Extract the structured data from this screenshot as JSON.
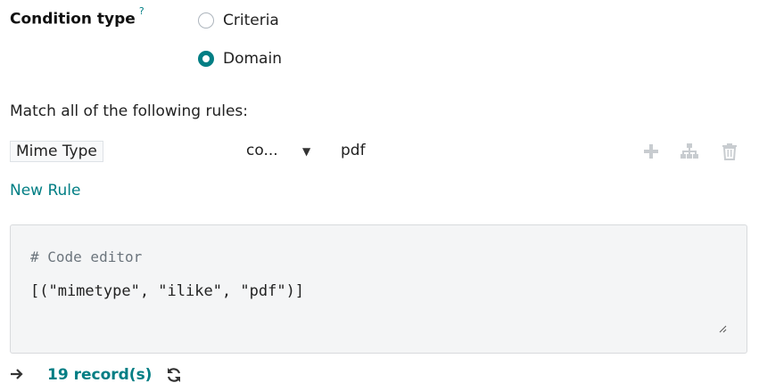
{
  "condition": {
    "label": "Condition type",
    "help_marker": "?",
    "options": [
      {
        "label": "Criteria",
        "checked": false
      },
      {
        "label": "Domain",
        "checked": true
      }
    ]
  },
  "rules": {
    "intro": "Match all of the following rules:",
    "items": [
      {
        "field": "Mime Type",
        "operator": "co...",
        "value": "pdf"
      }
    ],
    "new_rule_label": "New Rule"
  },
  "editor": {
    "comment": "# Code editor",
    "code": "[(\"mimetype\", \"ilike\", \"pdf\")]"
  },
  "footer": {
    "records_label": "19 record(s)"
  },
  "colors": {
    "accent": "#017e84",
    "muted_icon": "#c8ccd0"
  }
}
